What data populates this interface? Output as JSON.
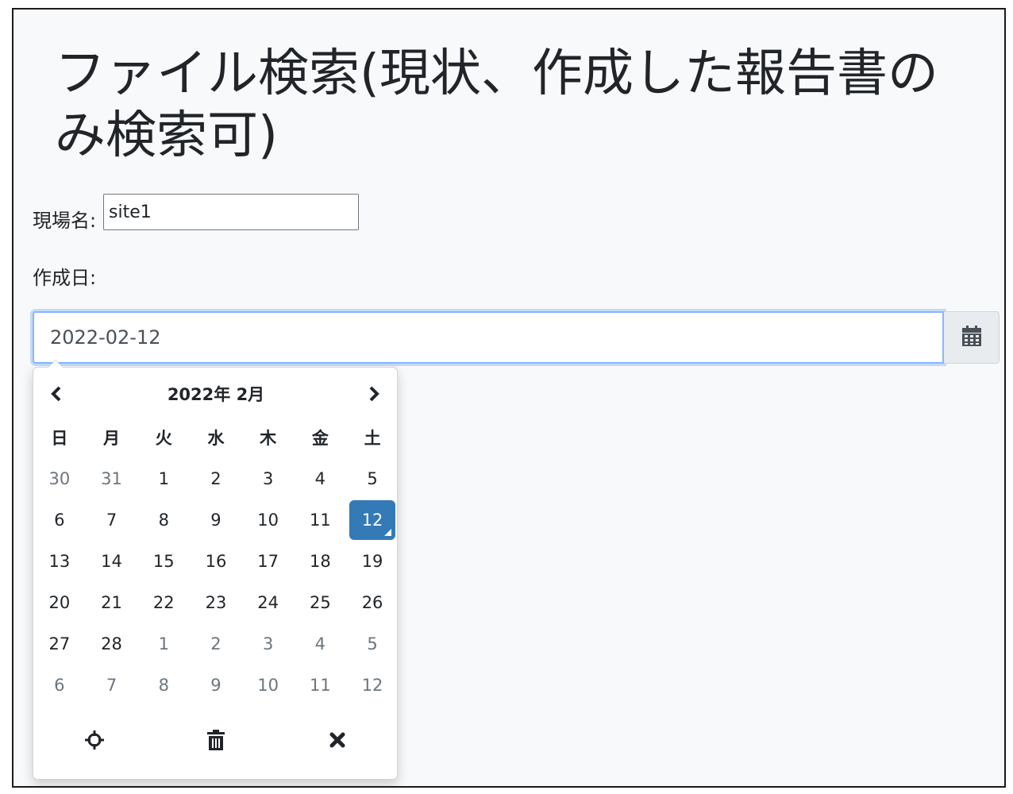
{
  "page": {
    "title": "ファイル検索(現状、作成した報告書のみ検索可)"
  },
  "form": {
    "site_label": "現場名:",
    "site_value": "site1",
    "date_label": "作成日:",
    "date_value": "2022-02-12"
  },
  "datepicker": {
    "month_label": "2022年 2月",
    "weekdays": [
      "日",
      "月",
      "火",
      "水",
      "木",
      "金",
      "土"
    ],
    "weeks": [
      [
        {
          "d": "30",
          "old": true
        },
        {
          "d": "31",
          "old": true
        },
        {
          "d": "1"
        },
        {
          "d": "2"
        },
        {
          "d": "3"
        },
        {
          "d": "4"
        },
        {
          "d": "5"
        }
      ],
      [
        {
          "d": "6"
        },
        {
          "d": "7"
        },
        {
          "d": "8"
        },
        {
          "d": "9"
        },
        {
          "d": "10"
        },
        {
          "d": "11"
        },
        {
          "d": "12",
          "active": true
        }
      ],
      [
        {
          "d": "13"
        },
        {
          "d": "14"
        },
        {
          "d": "15"
        },
        {
          "d": "16"
        },
        {
          "d": "17"
        },
        {
          "d": "18"
        },
        {
          "d": "19"
        }
      ],
      [
        {
          "d": "20"
        },
        {
          "d": "21"
        },
        {
          "d": "22"
        },
        {
          "d": "23"
        },
        {
          "d": "24"
        },
        {
          "d": "25"
        },
        {
          "d": "26"
        }
      ],
      [
        {
          "d": "27"
        },
        {
          "d": "28"
        },
        {
          "d": "1",
          "old": true
        },
        {
          "d": "2",
          "old": true
        },
        {
          "d": "3",
          "old": true
        },
        {
          "d": "4",
          "old": true
        },
        {
          "d": "5",
          "old": true
        }
      ],
      [
        {
          "d": "6",
          "old": true
        },
        {
          "d": "7",
          "old": true
        },
        {
          "d": "8",
          "old": true
        },
        {
          "d": "9",
          "old": true
        },
        {
          "d": "10",
          "old": true
        },
        {
          "d": "11",
          "old": true
        },
        {
          "d": "12",
          "old": true
        }
      ]
    ],
    "footer_icons": [
      "crosshairs-icon",
      "trash-icon",
      "close-icon"
    ]
  },
  "icons": {
    "calendar": "calendar-icon",
    "prev": "chevron-left-icon",
    "next": "chevron-right-icon"
  },
  "colors": {
    "active_day": "#337ab7",
    "focus_border": "#86b7fe",
    "accent": "#0d6efd",
    "page_bg": "#f8f9fa"
  }
}
